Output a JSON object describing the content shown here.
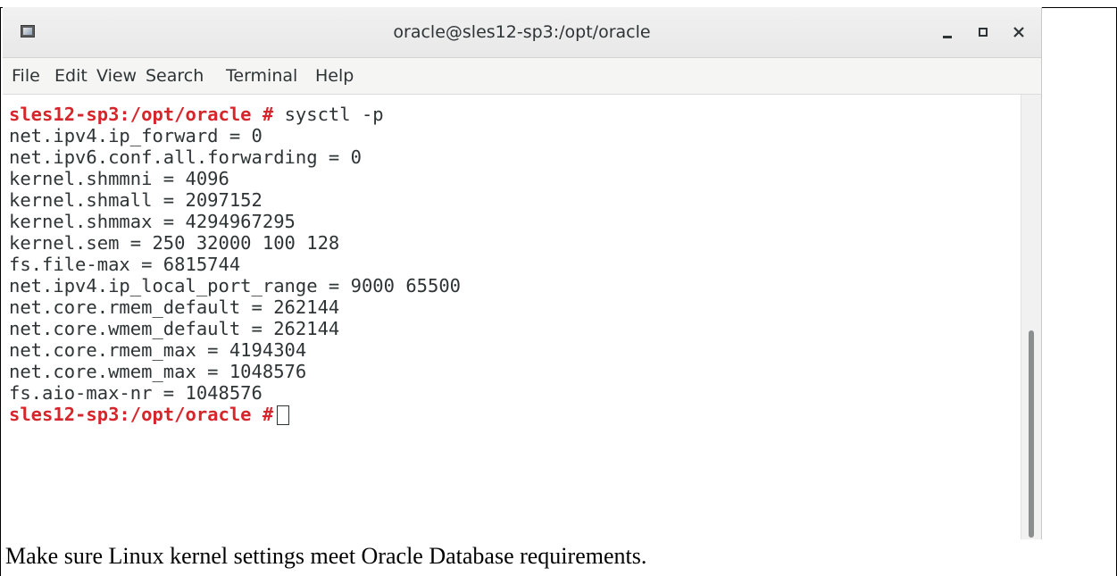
{
  "window": {
    "title": "oracle@sles12-sp3:/opt/oracle",
    "icon": "terminal-app-icon",
    "controls": [
      "minimize-icon",
      "maximize-icon",
      "close-icon"
    ]
  },
  "menu": {
    "file": "File",
    "edit": "Edit",
    "view": "View",
    "search": "Search",
    "terminal": "Terminal",
    "help": "Help"
  },
  "terminal": {
    "prompt": "sles12-sp3:/opt/oracle #",
    "command": "sysctl -p",
    "output": [
      "net.ipv4.ip_forward = 0",
      "net.ipv6.conf.all.forwarding = 0",
      "kernel.shmmni = 4096",
      "kernel.shmall = 2097152",
      "kernel.shmmax = 4294967295",
      "kernel.sem = 250 32000 100 128",
      "fs.file-max = 6815744",
      "net.ipv4.ip_local_port_range = 9000 65500",
      "net.core.rmem_default = 262144",
      "net.core.wmem_default = 262144",
      "net.core.rmem_max = 4194304",
      "net.core.wmem_max = 1048576",
      "fs.aio-max-nr = 1048576"
    ],
    "prompt_color": "#d7262b"
  },
  "caption": "Make sure Linux kernel settings meet Oracle Database requirements."
}
